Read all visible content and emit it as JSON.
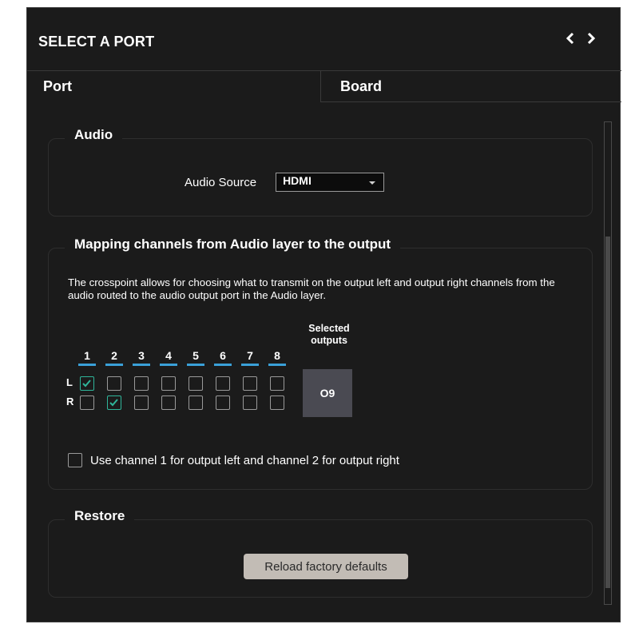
{
  "panel": {
    "title": "SELECT A PORT"
  },
  "nav": {
    "prev_icon": "chevron-left-icon",
    "next_icon": "chevron-right-icon"
  },
  "tabs": [
    {
      "label": "Port",
      "active": true
    },
    {
      "label": "Board",
      "active": false
    }
  ],
  "audio": {
    "legend": "Audio",
    "source_label": "Audio Source",
    "source_value": "HDMI"
  },
  "mapping": {
    "legend": "Mapping channels from Audio layer to the output",
    "description": "The crosspoint allows for choosing what to transmit on the output left and output right channels from the audio routed to the audio output port in the Audio layer.",
    "selected_outputs_label_1": "Selected",
    "selected_outputs_label_2": "outputs",
    "selected_output": "O9",
    "columns": [
      "1",
      "2",
      "3",
      "4",
      "5",
      "6",
      "7",
      "8"
    ],
    "rows": [
      {
        "label": "L",
        "checked": [
          true,
          false,
          false,
          false,
          false,
          false,
          false,
          false
        ]
      },
      {
        "label": "R",
        "checked": [
          false,
          true,
          false,
          false,
          false,
          false,
          false,
          false
        ]
      }
    ],
    "use_channel_label": "Use channel 1 for output left and channel 2 for output right",
    "use_channel_checked": false
  },
  "restore": {
    "legend": "Restore",
    "reload_label": "Reload factory defaults"
  },
  "colors": {
    "background": "#1b1b1b",
    "accent": "#3aa0d8",
    "check": "#2fb59a",
    "button": "#c2bcb5",
    "output_box": "#4a4a52"
  }
}
